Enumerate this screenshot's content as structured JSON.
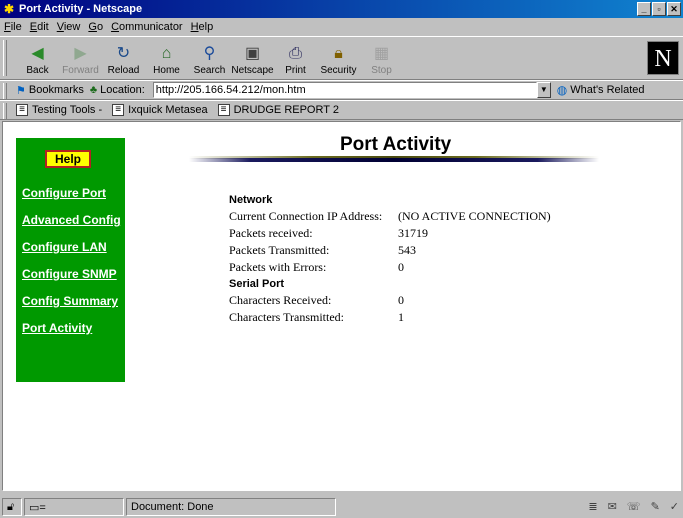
{
  "window": {
    "title": "Port Activity - Netscape"
  },
  "menu": [
    "File",
    "Edit",
    "View",
    "Go",
    "Communicator",
    "Help"
  ],
  "toolbar": {
    "buttons": [
      {
        "label": "Back",
        "icon": "back-arrow-icon",
        "enabled": true
      },
      {
        "label": "Forward",
        "icon": "forward-arrow-icon",
        "enabled": false
      },
      {
        "label": "Reload",
        "icon": "reload-icon",
        "enabled": true
      },
      {
        "label": "Home",
        "icon": "home-icon",
        "enabled": true
      },
      {
        "label": "Search",
        "icon": "search-icon",
        "enabled": true
      },
      {
        "label": "Netscape",
        "icon": "netscape-icon",
        "enabled": true
      },
      {
        "label": "Print",
        "icon": "print-icon",
        "enabled": true
      },
      {
        "label": "Security",
        "icon": "security-icon",
        "enabled": true
      },
      {
        "label": "Stop",
        "icon": "stop-icon",
        "enabled": false
      }
    ]
  },
  "location": {
    "bookmarks_label": "Bookmarks",
    "location_label": "Location:",
    "url": "http://205.166.54.212/mon.htm",
    "related_label": "What's Related"
  },
  "personal_toolbar": [
    "Testing Tools -",
    "Ixquick Metasea",
    "DRUDGE REPORT 2"
  ],
  "sidebar": {
    "help_label": "Help",
    "links": [
      "Configure Port",
      "Advanced Config",
      "Configure LAN",
      "Configure SNMP",
      "Config Summary",
      "Port Activity"
    ],
    "bg_color": "#009900",
    "help_color": "#ffff00"
  },
  "page": {
    "title": "Port Activity",
    "network_heading": "Network",
    "network_rows": [
      {
        "label": "Current Connection IP Address:",
        "value": "(NO ACTIVE CONNECTION)"
      },
      {
        "label": "Packets received:",
        "value": "31719"
      },
      {
        "label": "Packets Transmitted:",
        "value": "543"
      },
      {
        "label": "Packets with Errors:",
        "value": "0"
      }
    ],
    "serial_heading": "Serial Port",
    "serial_rows": [
      {
        "label": "Characters Received:",
        "value": "0"
      },
      {
        "label": "Characters Transmitted:",
        "value": "1"
      }
    ]
  },
  "status": {
    "text": "Document: Done"
  }
}
